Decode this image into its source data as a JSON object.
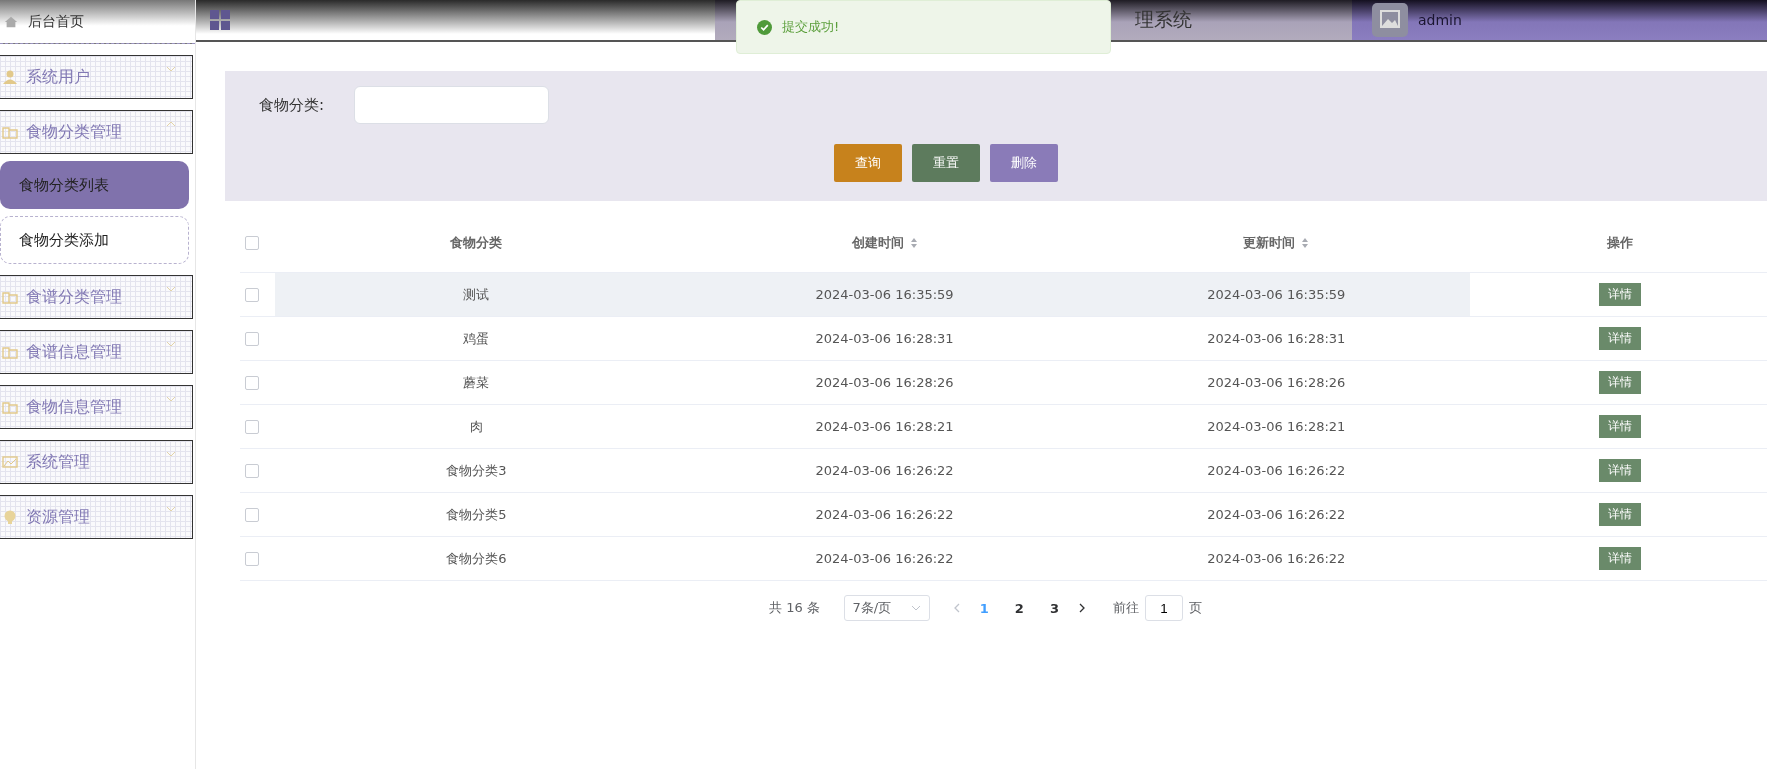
{
  "sidebar": {
    "home": {
      "label": "后台首页"
    },
    "items": [
      {
        "label": "系统用户",
        "kind": "user",
        "expanded": false
      },
      {
        "label": "食物分类管理",
        "kind": "folder",
        "expanded": true,
        "children": [
          {
            "label": "食物分类列表",
            "selected": true
          },
          {
            "label": "食物分类添加",
            "selected": false
          }
        ]
      },
      {
        "label": "食谱分类管理",
        "kind": "folder",
        "expanded": false
      },
      {
        "label": "食谱信息管理",
        "kind": "folder",
        "expanded": false
      },
      {
        "label": "食物信息管理",
        "kind": "folder",
        "expanded": false
      },
      {
        "label": "系统管理",
        "kind": "image",
        "expanded": false
      },
      {
        "label": "资源管理",
        "kind": "bulb",
        "expanded": false
      }
    ]
  },
  "header": {
    "title": "理系统",
    "user": "admin"
  },
  "toast": {
    "message": "提交成功!"
  },
  "filter": {
    "label": "食物分类:",
    "buttons": [
      {
        "label": "查询",
        "color": "#c7821c"
      },
      {
        "label": "重置",
        "color": "#5d7b5d"
      },
      {
        "label": "删除",
        "color": "#8a7bb8"
      }
    ]
  },
  "table": {
    "select_all": {
      "checked": false
    },
    "columns": [
      {
        "label": "食物分类",
        "sortable": false
      },
      {
        "label": "创建时间",
        "sortable": true
      },
      {
        "label": "更新时间",
        "sortable": true
      },
      {
        "label": "操作",
        "sortable": false
      }
    ],
    "rows": [
      {
        "name": "测试",
        "created": "2024-03-06 16:35:59",
        "updated": "2024-03-06 16:35:59",
        "action": "详情",
        "hovered": true,
        "checked": false
      },
      {
        "name": "鸡蛋",
        "created": "2024-03-06 16:28:31",
        "updated": "2024-03-06 16:28:31",
        "action": "详情",
        "hovered": false,
        "checked": false
      },
      {
        "name": "蘑菜",
        "created": "2024-03-06 16:28:26",
        "updated": "2024-03-06 16:28:26",
        "action": "详情",
        "hovered": false,
        "checked": false
      },
      {
        "name": "肉",
        "created": "2024-03-06 16:28:21",
        "updated": "2024-03-06 16:28:21",
        "action": "详情",
        "hovered": false,
        "checked": false
      },
      {
        "name": "食物分类3",
        "created": "2024-03-06 16:26:22",
        "updated": "2024-03-06 16:26:22",
        "action": "详情",
        "hovered": false,
        "checked": false
      },
      {
        "name": "食物分类5",
        "created": "2024-03-06 16:26:22",
        "updated": "2024-03-06 16:26:22",
        "action": "详情",
        "hovered": false,
        "checked": false
      },
      {
        "name": "食物分类6",
        "created": "2024-03-06 16:26:22",
        "updated": "2024-03-06 16:26:22",
        "action": "详情",
        "hovered": false,
        "checked": false
      }
    ]
  },
  "pagination": {
    "total": "共 16 条",
    "page_size": "7条/页",
    "pages": [
      {
        "label": "1",
        "selected": true
      },
      {
        "label": "2",
        "selected": false
      },
      {
        "label": "3",
        "selected": false
      }
    ],
    "goto_label": "前往",
    "goto_value": "1",
    "goto_suffix": "页"
  }
}
